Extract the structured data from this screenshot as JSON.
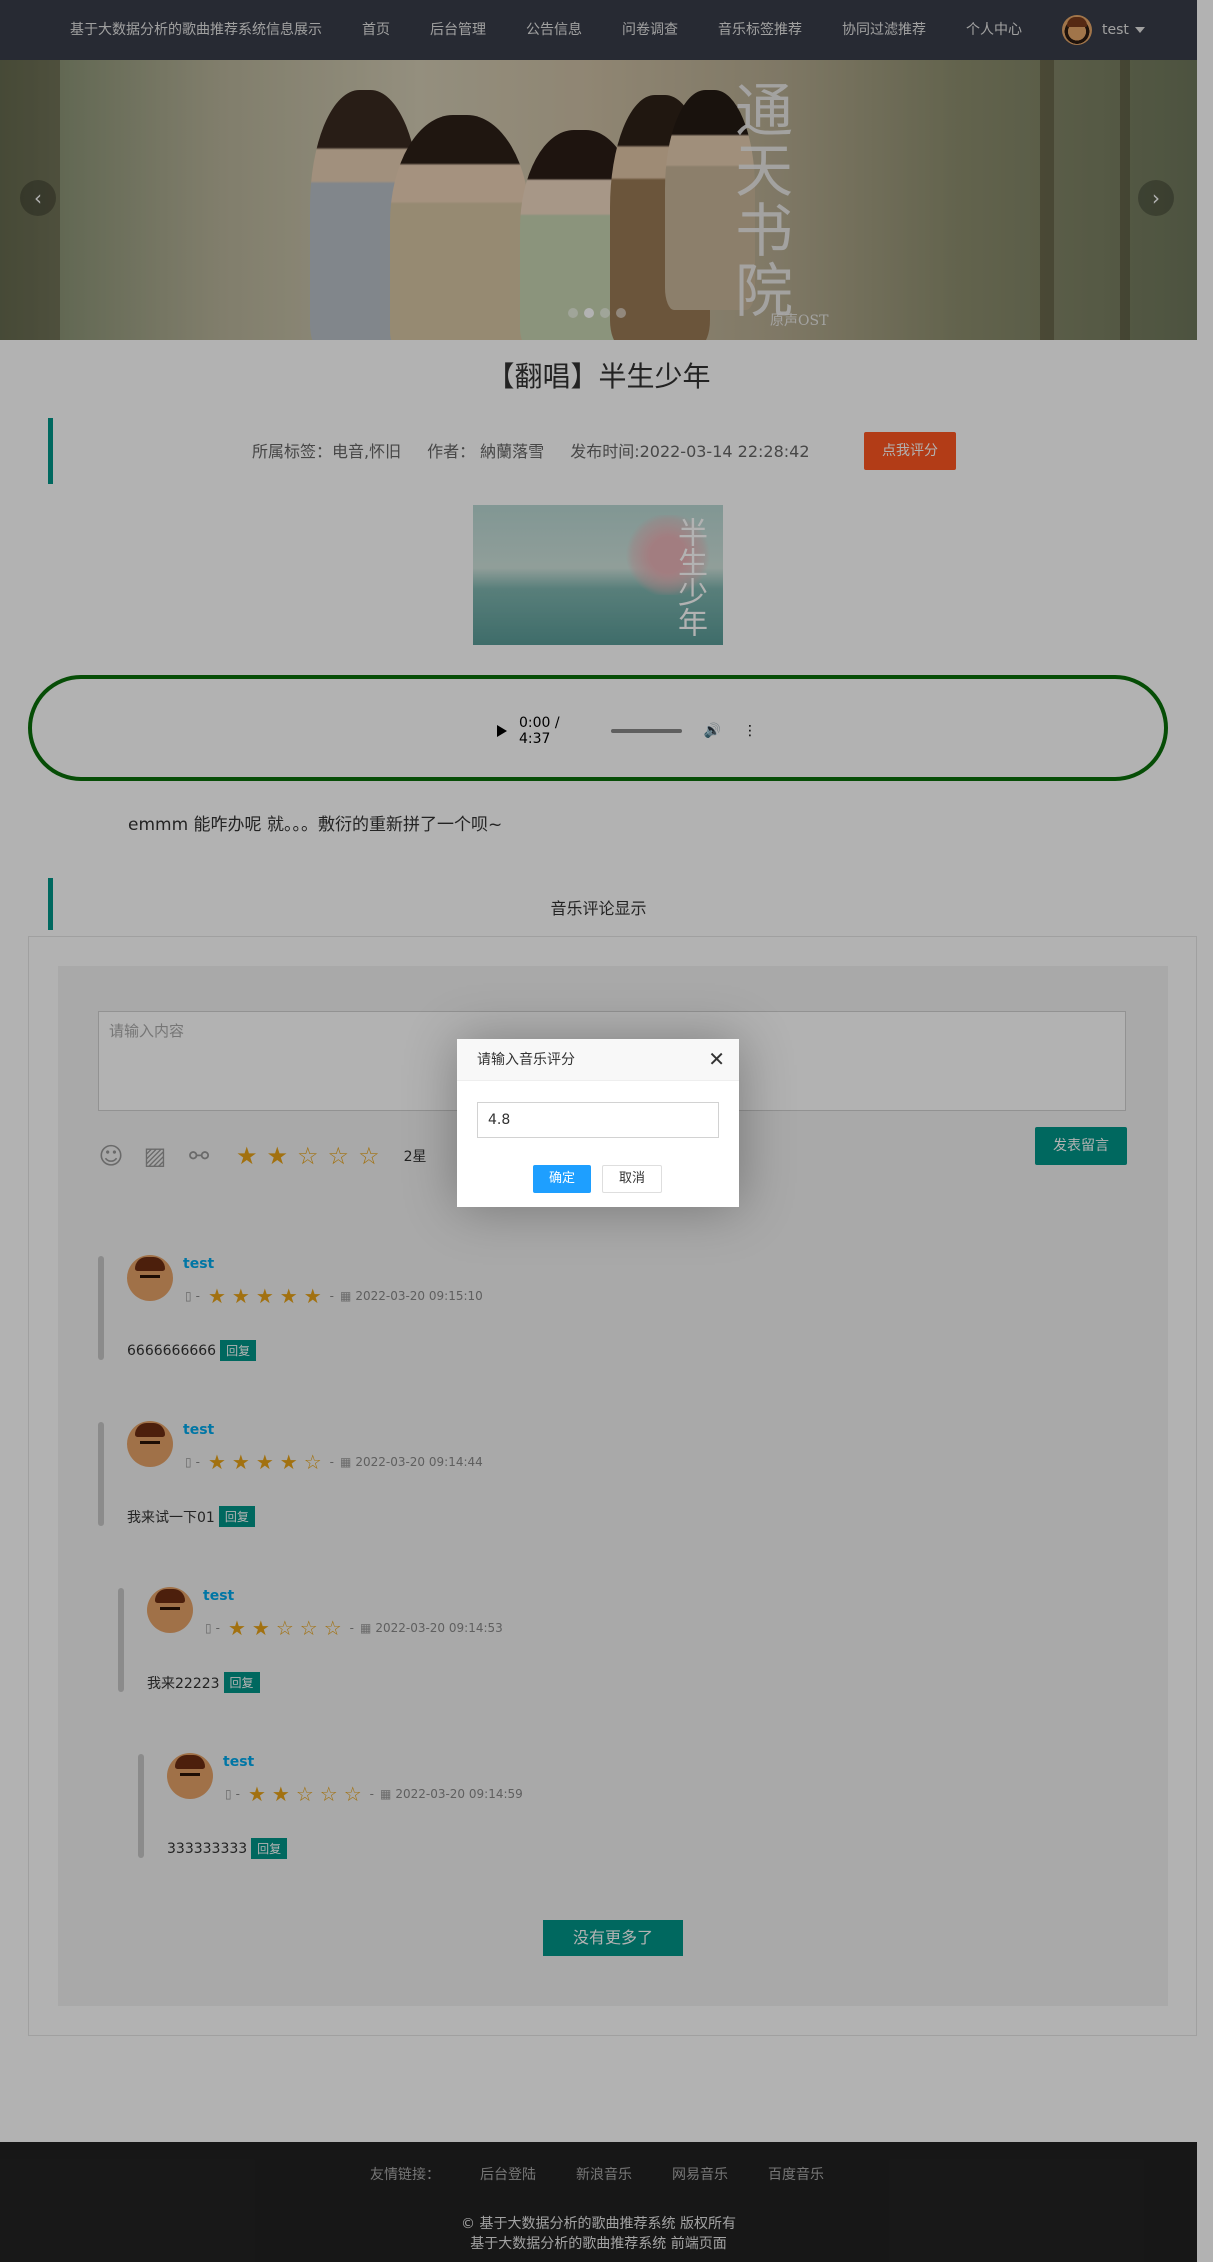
{
  "nav": {
    "brand": "基于大数据分析的歌曲推荐系统信息展示",
    "items": [
      "首页",
      "后台管理",
      "公告信息",
      "问卷调查",
      "音乐标签推荐",
      "协同过滤推荐",
      "个人中心"
    ],
    "username": "test"
  },
  "banner": {
    "title_art": "通天书院",
    "subtitle": "原声OST",
    "prev": "‹",
    "next": "›"
  },
  "song": {
    "title": "【翻唱】半生少年",
    "tags": "所属标签：电音,怀旧",
    "author": "作者：  納蘭落雪",
    "publish_time": "发布时间:2022-03-14 22:28:42",
    "rate_button": "点我评分",
    "cover_caption": "半生少年",
    "description": "emmm 能咋办呢 就。。。敷衍的重新拼了一个呗~"
  },
  "player": {
    "time": "0:00 / 4:37"
  },
  "comments_section": {
    "title": "音乐评论显示",
    "placeholder": "请输入内容",
    "rating_text": "2星",
    "rating_value": 2,
    "post_button": "发表留言",
    "items": [
      {
        "user": "test",
        "stars": 5,
        "time": "2022-03-20 09:15:10",
        "text": "6666666666",
        "reply": "回复"
      },
      {
        "user": "test",
        "stars": 4,
        "time": "2022-03-20 09:14:44",
        "text": "我来试一下01",
        "reply": "回复"
      },
      {
        "user": "test",
        "stars": 2,
        "time": "2022-03-20 09:14:53",
        "text": "我来22223",
        "reply": "回复"
      },
      {
        "user": "test",
        "stars": 2,
        "time": "2022-03-20 09:14:59",
        "text": "333333333",
        "reply": "回复"
      }
    ],
    "no_more": "没有更多了"
  },
  "footer": {
    "links_label": "友情链接：",
    "links": [
      "后台登陆",
      "新浪音乐",
      "网易音乐",
      "百度音乐"
    ],
    "copyright": "© 基于大数据分析的歌曲推荐系统 版权所有",
    "copyright2": "基于大数据分析的歌曲推荐系统 前端页面"
  },
  "modal": {
    "title": "请输入音乐评分",
    "value": "4.8",
    "ok": "确定",
    "cancel": "取消"
  },
  "colors": {
    "nav_bg": "#393d49",
    "accent": "#009688",
    "rate_button": "#ff5722",
    "modal_ok": "#1e9fff",
    "star": "#e8a317"
  }
}
